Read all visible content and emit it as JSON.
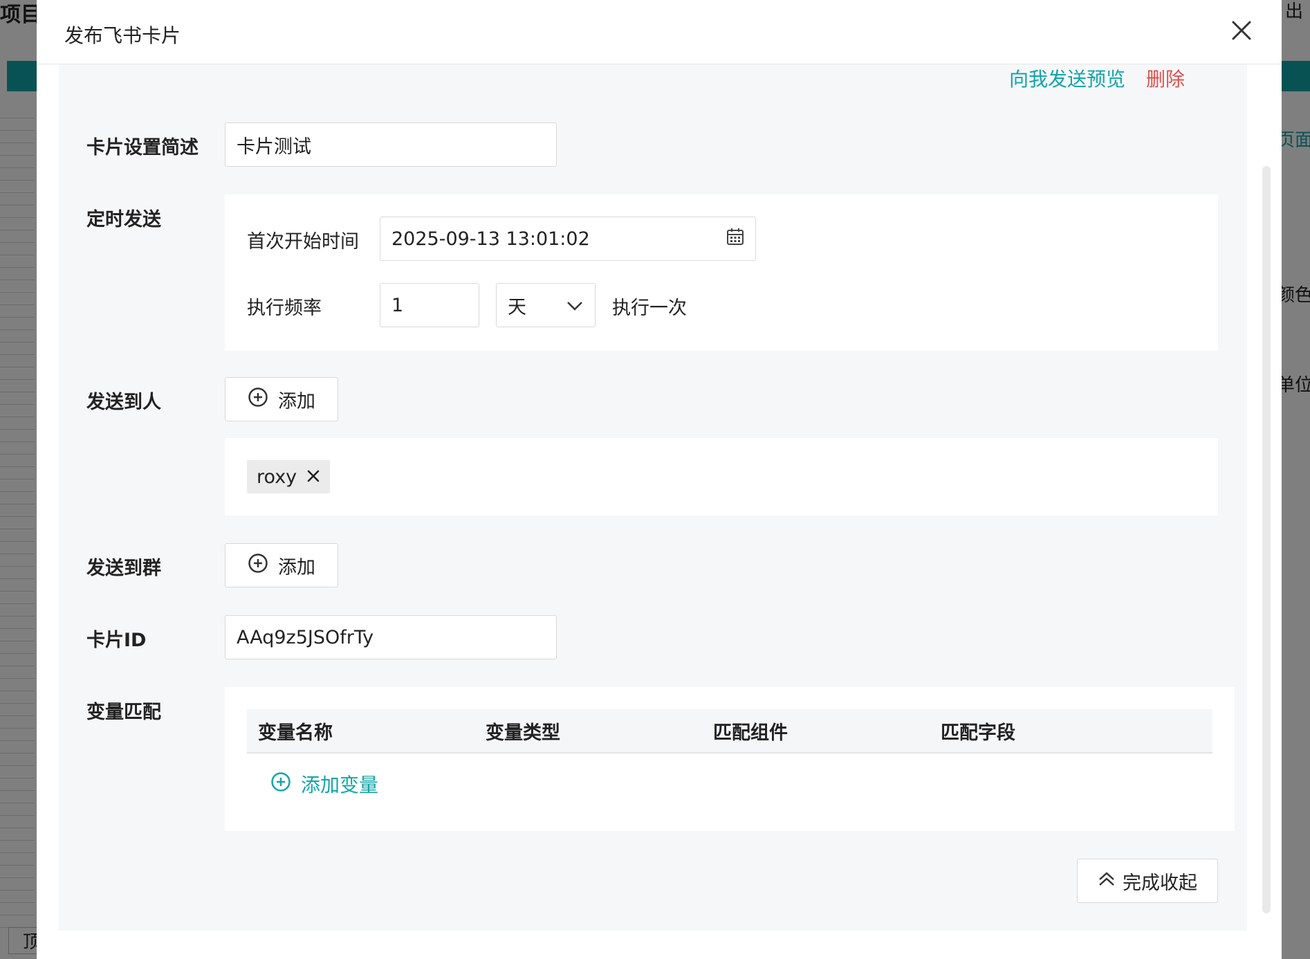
{
  "background": {
    "fragments": [
      "项目",
      "出",
      "页面",
      "颜色",
      "单位",
      "顶"
    ]
  },
  "modal": {
    "title": "发布飞书卡片",
    "actions": {
      "preview": "向我发送预览",
      "delete": "删除"
    },
    "summary": {
      "label": "卡片设置简述",
      "value": "卡片测试"
    },
    "schedule": {
      "label": "定时发送",
      "start_label": "首次开始时间",
      "start_value": "2025-09-13 13:01:02",
      "freq_label": "执行频率",
      "freq_value": "1",
      "freq_unit": "天",
      "freq_suffix": "执行一次"
    },
    "send_person": {
      "label": "发送到人",
      "add": "添加",
      "tags": [
        "roxy"
      ]
    },
    "send_group": {
      "label": "发送到群",
      "add": "添加"
    },
    "card_id": {
      "label": "卡片ID",
      "value": "AAq9z5JSOfrTy"
    },
    "variables": {
      "label": "变量匹配",
      "columns": [
        "变量名称",
        "变量类型",
        "匹配组件",
        "匹配字段"
      ],
      "add": "添加变量"
    },
    "collapse": "完成收起"
  },
  "colors": {
    "accent": "#12a5a8",
    "danger": "#e0504b"
  }
}
